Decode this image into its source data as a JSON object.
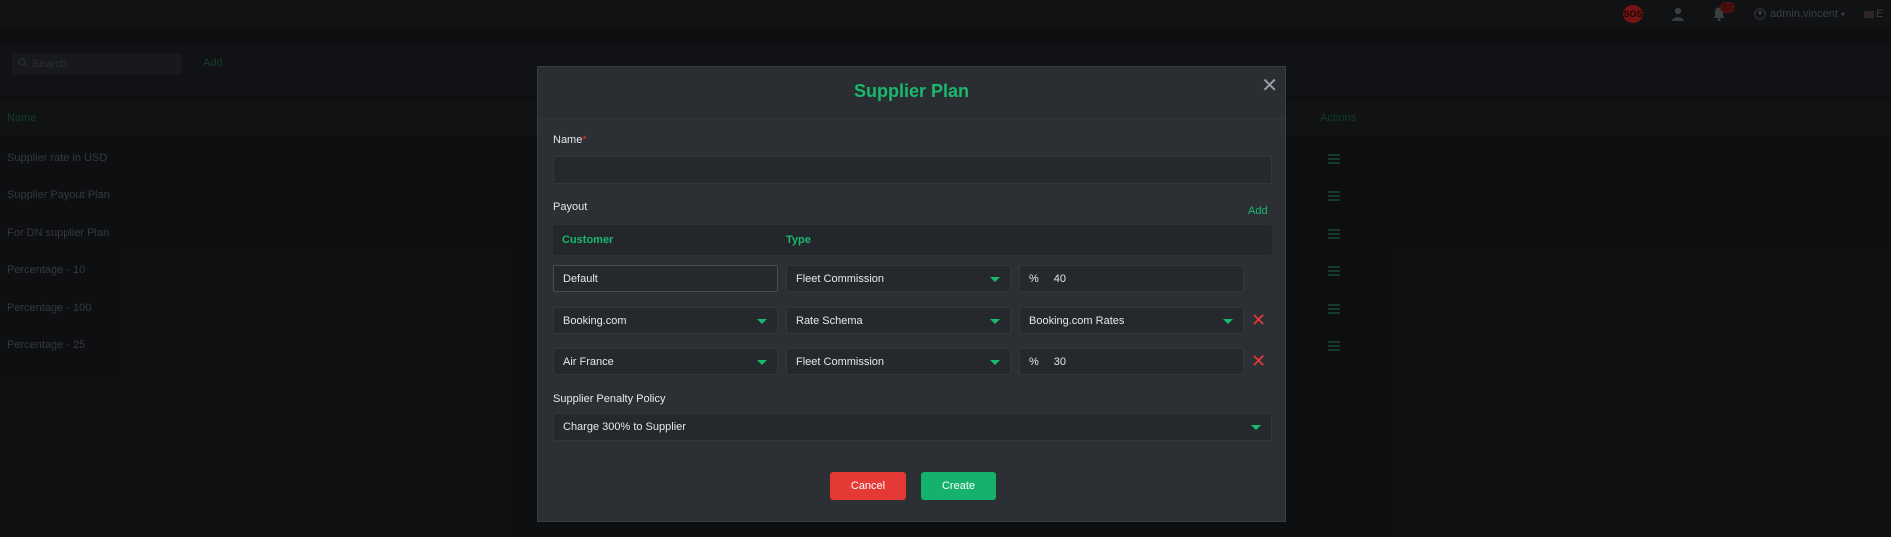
{
  "topbar": {
    "sos_label": "SOS",
    "notifications_count": "57",
    "user_name": "admin.vincent",
    "flag_text": "E"
  },
  "page": {
    "search_placeholder": "Search",
    "add_label": "Add",
    "table_headers": {
      "name": "Name",
      "actions": "Actions"
    },
    "rows": [
      "Supplier rate in USD",
      "Supplier Payout Plan",
      "For DN supplier Plan",
      "Percentage - 10",
      "Percentage - 100",
      "Percentage - 25"
    ]
  },
  "modal": {
    "title": "Supplier Plan",
    "name_label": "Name",
    "name_value": "",
    "payout_label": "Payout",
    "add_label": "Add",
    "columns": {
      "customer": "Customer",
      "type": "Type"
    },
    "payout_rows": [
      {
        "customer": "Default",
        "type": "Fleet Commission",
        "value_prefix": "%",
        "value": "40"
      },
      {
        "customer": "Booking.com",
        "type": "Rate Schema",
        "value": "Booking.com Rates"
      },
      {
        "customer": "Air France",
        "type": "Fleet Commission",
        "value_prefix": "%",
        "value": "30"
      }
    ],
    "penalty_label": "Supplier Penalty Policy",
    "penalty_value": "Charge 300% to Supplier",
    "cancel_label": "Cancel",
    "create_label": "Create"
  },
  "colors": {
    "accent": "#19b96e",
    "danger": "#e53935",
    "modal_bg": "#2c2f34"
  }
}
